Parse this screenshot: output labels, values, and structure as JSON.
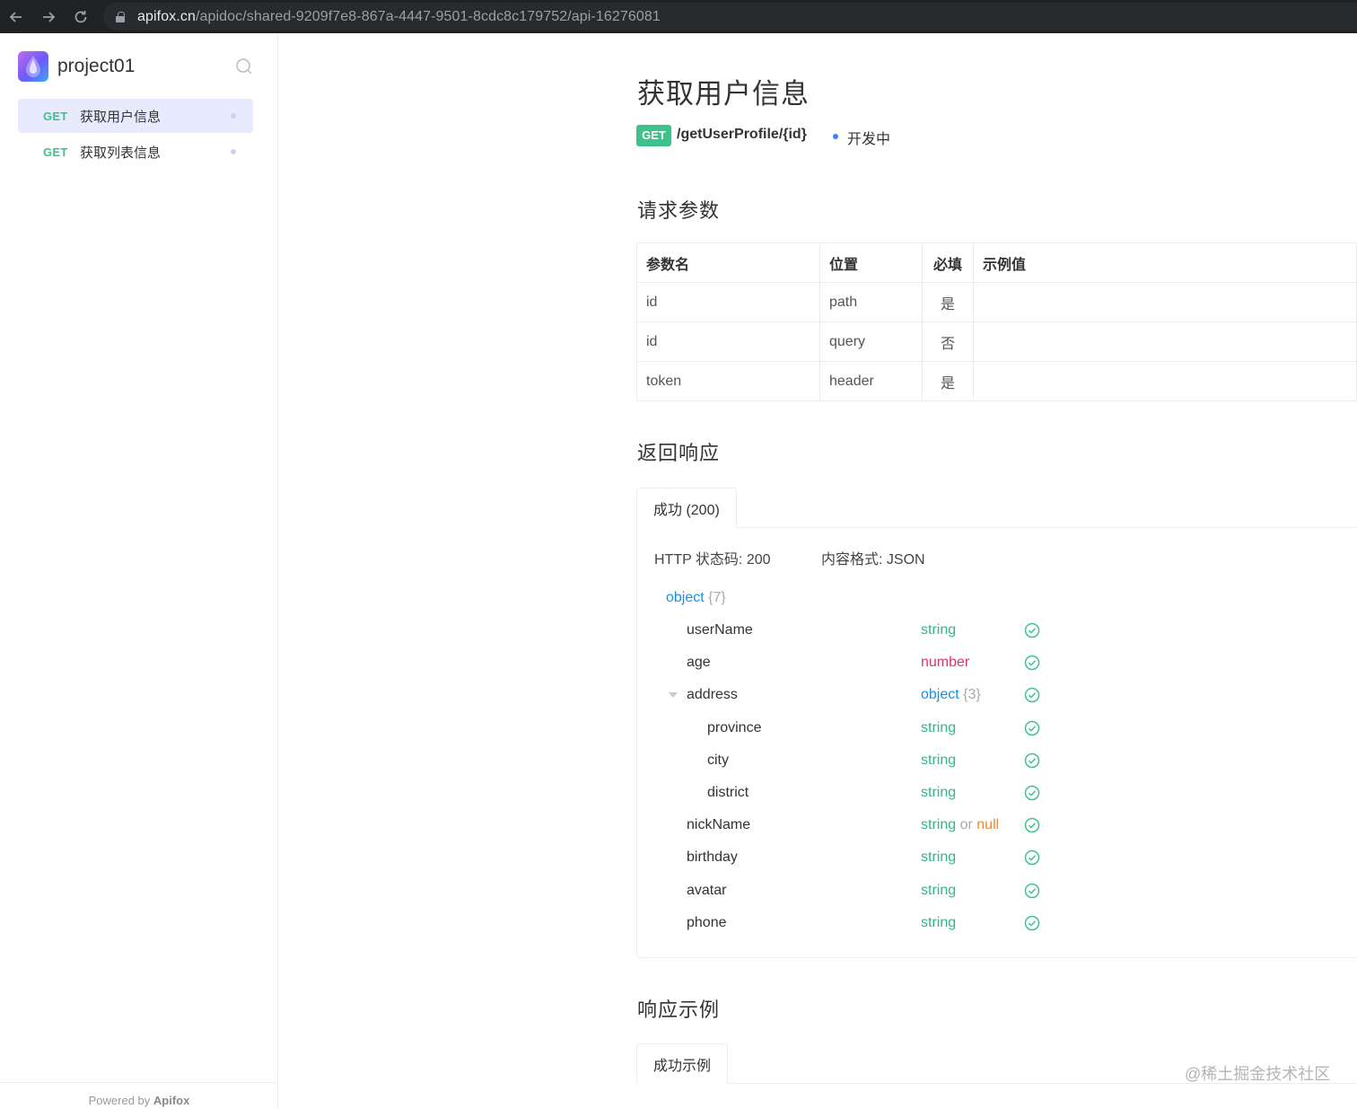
{
  "browser": {
    "url_host": "apifox.cn",
    "url_path": "/apidoc/shared-9209f7e8-867a-4447-9501-8cdc8c179752/api-16276081"
  },
  "sidebar": {
    "project_name": "project01",
    "items": [
      {
        "method": "GET",
        "label": "获取用户信息",
        "active": true
      },
      {
        "method": "GET",
        "label": "获取列表信息",
        "active": false
      }
    ],
    "powered_prefix": "Powered by",
    "powered_brand": "Apifox"
  },
  "api": {
    "title": "获取用户信息",
    "method": "GET",
    "path": "/getUserProfile/{id}",
    "status": "开发中"
  },
  "request": {
    "heading": "请求参数",
    "columns": [
      "参数名",
      "位置",
      "必填",
      "示例值"
    ],
    "rows": [
      [
        "id",
        "path",
        "是",
        ""
      ],
      [
        "id",
        "query",
        "否",
        ""
      ],
      [
        "token",
        "header",
        "是",
        ""
      ]
    ]
  },
  "response": {
    "heading": "返回响应",
    "tab": "成功 (200)",
    "http_status": "HTTP 状态码: 200",
    "content_type": "内容格式: JSON",
    "root_type": "object",
    "root_count": "{7}",
    "fields": [
      {
        "name": "userName",
        "type": "string",
        "depth": 0
      },
      {
        "name": "age",
        "type": "number",
        "depth": 0
      },
      {
        "name": "address",
        "type": "object",
        "count": "{3}",
        "depth": 0,
        "expanded": true
      },
      {
        "name": "province",
        "type": "string",
        "depth": 1
      },
      {
        "name": "city",
        "type": "string",
        "depth": 1
      },
      {
        "name": "district",
        "type": "string",
        "depth": 1
      },
      {
        "name": "nickName",
        "type": "string",
        "or": "or",
        "alt": "null",
        "depth": 0
      },
      {
        "name": "birthday",
        "type": "string",
        "depth": 0
      },
      {
        "name": "avatar",
        "type": "string",
        "depth": 0
      },
      {
        "name": "phone",
        "type": "string",
        "depth": 0
      }
    ]
  },
  "example": {
    "heading": "响应示例",
    "tab": "成功示例"
  },
  "watermark": "@稀土掘金技术社区",
  "colors": {
    "get_green": "#3ec28c",
    "type_string": "#2fb689",
    "type_number": "#e0306e",
    "type_object": "#1a8fe0",
    "type_null": "#f08a24",
    "status_dot": "#3b82f6",
    "active_bg": "#e8ebfd"
  }
}
